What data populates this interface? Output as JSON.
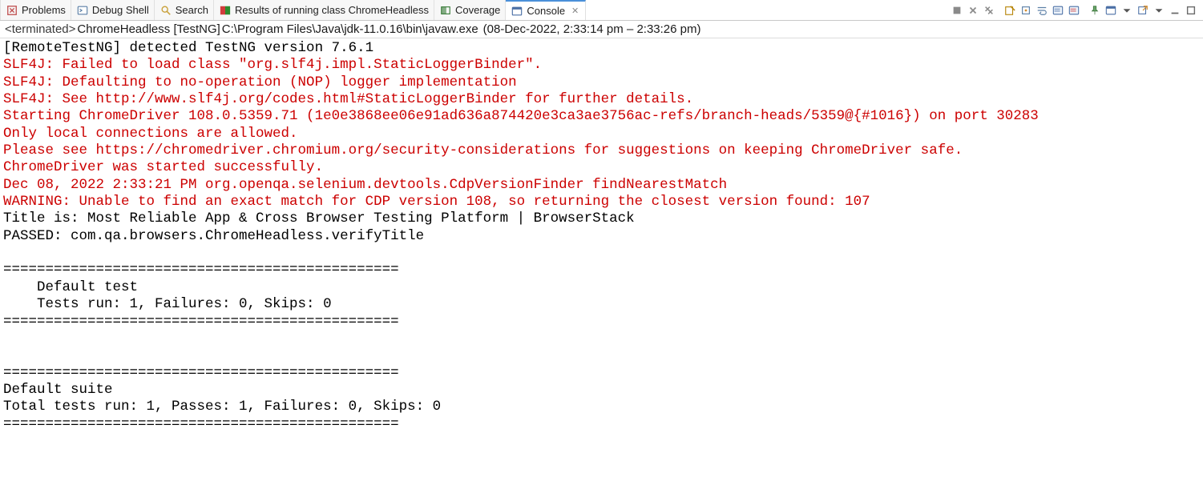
{
  "tabs": [
    {
      "label": "Problems",
      "icon": "problems-icon"
    },
    {
      "label": "Debug Shell",
      "icon": "debug-shell-icon"
    },
    {
      "label": "Search",
      "icon": "search-icon"
    },
    {
      "label": "Results of running class ChromeHeadless",
      "icon": "testng-results-icon"
    },
    {
      "label": "Coverage",
      "icon": "coverage-icon"
    },
    {
      "label": "Console",
      "icon": "console-icon",
      "active": true,
      "closable": true
    }
  ],
  "toolbar_icons": [
    "terminate-icon",
    "remove-launch-icon",
    "remove-all-terminated-icon",
    "sep",
    "clear-console-icon",
    "scroll-lock-icon",
    "word-wrap-icon",
    "show-output-icon",
    "show-errors-icon",
    "sep",
    "pin-console-icon",
    "display-selected-console-icon",
    "console-menu-icon",
    "open-console-icon",
    "view-menu-icon",
    "minimize-icon",
    "maximize-icon"
  ],
  "process": {
    "status": "<terminated>",
    "name": "ChromeHeadless [TestNG]",
    "path": "C:\\Program Files\\Java\\jdk-11.0.16\\bin\\javaw.exe",
    "time": "(08-Dec-2022, 2:33:14 pm – 2:33:26 pm)"
  },
  "console_lines": [
    {
      "t": "out",
      "s": "[RemoteTestNG] detected TestNG version 7.6.1"
    },
    {
      "t": "err",
      "s": "SLF4J: Failed to load class \"org.slf4j.impl.StaticLoggerBinder\"."
    },
    {
      "t": "err",
      "s": "SLF4J: Defaulting to no-operation (NOP) logger implementation"
    },
    {
      "t": "err",
      "s": "SLF4J: See http://www.slf4j.org/codes.html#StaticLoggerBinder for further details."
    },
    {
      "t": "err",
      "s": "Starting ChromeDriver 108.0.5359.71 (1e0e3868ee06e91ad636a874420e3ca3ae3756ac-refs/branch-heads/5359@{#1016}) on port 30283"
    },
    {
      "t": "err",
      "s": "Only local connections are allowed."
    },
    {
      "t": "err",
      "s": "Please see https://chromedriver.chromium.org/security-considerations for suggestions on keeping ChromeDriver safe."
    },
    {
      "t": "err",
      "s": "ChromeDriver was started successfully."
    },
    {
      "t": "err",
      "s": "Dec 08, 2022 2:33:21 PM org.openqa.selenium.devtools.CdpVersionFinder findNearestMatch"
    },
    {
      "t": "err",
      "s": "WARNING: Unable to find an exact match for CDP version 108, so returning the closest version found: 107"
    },
    {
      "t": "out",
      "s": "Title is: Most Reliable App & Cross Browser Testing Platform | BrowserStack"
    },
    {
      "t": "out",
      "s": "PASSED: com.qa.browsers.ChromeHeadless.verifyTitle"
    },
    {
      "t": "out",
      "s": ""
    },
    {
      "t": "out",
      "s": "==============================================="
    },
    {
      "t": "out",
      "s": "    Default test"
    },
    {
      "t": "out",
      "s": "    Tests run: 1, Failures: 0, Skips: 0"
    },
    {
      "t": "out",
      "s": "==============================================="
    },
    {
      "t": "out",
      "s": ""
    },
    {
      "t": "out",
      "s": ""
    },
    {
      "t": "out",
      "s": "==============================================="
    },
    {
      "t": "out",
      "s": "Default suite"
    },
    {
      "t": "out",
      "s": "Total tests run: 1, Passes: 1, Failures: 0, Skips: 0"
    },
    {
      "t": "out",
      "s": "==============================================="
    },
    {
      "t": "out",
      "s": ""
    },
    {
      "t": "out",
      "s": ""
    }
  ]
}
